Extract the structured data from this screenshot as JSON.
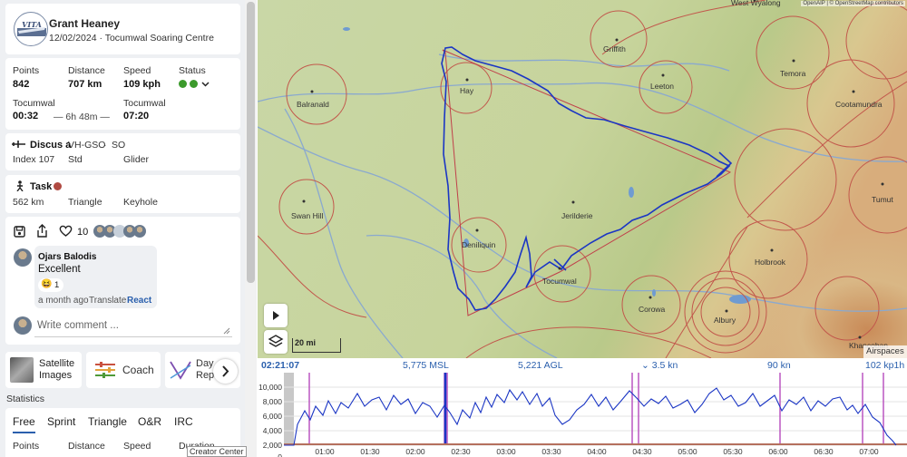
{
  "pilot": {
    "name": "Grant Heaney",
    "date": "12/02/2024",
    "site": "Tocumwal Soaring Centre",
    "logo_text": "ʌITA"
  },
  "summary": {
    "points_label": "Points",
    "points": "842",
    "distance_label": "Distance",
    "distance": "707 km",
    "speed_label": "Speed",
    "speed": "109 kph",
    "status_label": "Status",
    "takeoff_site": "Tocumwal",
    "takeoff_time": "00:32",
    "duration": "— 6h 48m —",
    "landing_site": "Tocumwal",
    "landing_time": "07:20"
  },
  "glider": {
    "model": "Discus a",
    "rego": "VH-GSO",
    "comp": "SO",
    "index": "Index 107",
    "class": "Std",
    "type": "Glider"
  },
  "task": {
    "title": "Task",
    "distance": "562 km",
    "shape": "Triangle",
    "zone": "Keyhole"
  },
  "social": {
    "likes": "10",
    "comment_author": "Ojars Balodis",
    "comment_text": "Excellent",
    "reaction_count": "1",
    "comment_time": "a month ago",
    "translate": "Translate",
    "react": "React",
    "write_placeholder": "Write comment ..."
  },
  "tools": [
    {
      "label": "Satellite Images"
    },
    {
      "label": "Coach"
    },
    {
      "label": "Day Rep"
    }
  ],
  "statistics": {
    "heading": "Statistics",
    "tabs": [
      "Free",
      "Sprint",
      "Triangle",
      "O&R",
      "IRC"
    ],
    "active_tab": "Free",
    "columns": [
      "Points",
      "Distance",
      "Speed",
      "Duration"
    ]
  },
  "creator_tooltip": "Creator Center",
  "map": {
    "attribution": "OpenAIP | © OpenStreetMap contributors",
    "scale_label": "20 mi",
    "airspaces_label": "Airspaces",
    "towns": [
      {
        "name": "West Wyalong"
      },
      {
        "name": "Griffith"
      },
      {
        "name": "Temora"
      },
      {
        "name": "Hay"
      },
      {
        "name": "Leeton"
      },
      {
        "name": "Balranald"
      },
      {
        "name": "Cootamundra"
      },
      {
        "name": "Tumut"
      },
      {
        "name": "Swan Hill"
      },
      {
        "name": "Jerilderie"
      },
      {
        "name": "Deniliquin"
      },
      {
        "name": "Tocumwal"
      },
      {
        "name": "Holbrook"
      },
      {
        "name": "Corowa"
      },
      {
        "name": "Albury"
      },
      {
        "name": "Khancoban"
      }
    ]
  },
  "barogram": {
    "time": "02:21:07",
    "msl": "5,775 MSL",
    "agl": "5,221 AGL",
    "vario": "3.5 kn",
    "ground_speed": "90 kn",
    "airspeed": "102 kp1h",
    "chevron": "⌄",
    "y_ticks": [
      "10,000",
      "8,000",
      "6,000",
      "4,000",
      "2,000",
      "0"
    ],
    "x_ticks": [
      "01:00",
      "01:30",
      "02:00",
      "02:30",
      "03:00",
      "03:30",
      "04:00",
      "04:30",
      "05:00",
      "05:30",
      "06:00",
      "06:30",
      "07:00"
    ]
  },
  "colors": {
    "accent": "#2a5fad",
    "track": "#1b36c4",
    "task_line": "#c0404a",
    "airspace": "#c2584c"
  }
}
